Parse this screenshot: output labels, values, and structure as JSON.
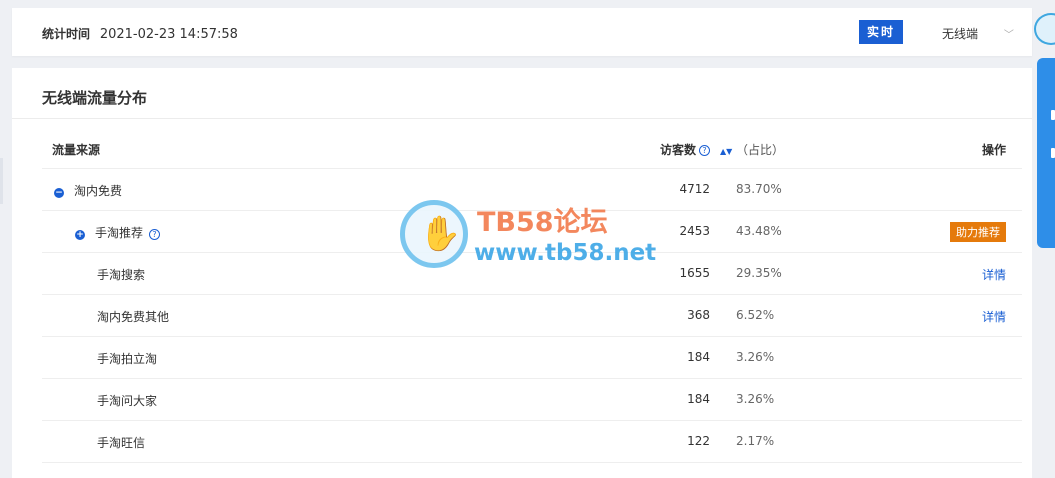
{
  "topbar": {
    "stat_label": "统计时间",
    "stat_time": "2021-02-23 14:57:58",
    "realtime_btn": "实时",
    "device": "无线端",
    "device_chevron": "﹀"
  },
  "card": {
    "title": "无线端流量分布",
    "headers": {
      "source": "流量来源",
      "visitors": "访客数",
      "ratio": "（占比）",
      "op": "操作"
    }
  },
  "rows": [
    {
      "source": "淘内免费",
      "visitors": "4712",
      "ratio": "83.70%",
      "op": ""
    },
    {
      "source": "手淘推荐",
      "visitors": "2453",
      "ratio": "43.48%",
      "op": "助力推荐"
    },
    {
      "source": "手淘搜索",
      "visitors": "1655",
      "ratio": "29.35%",
      "op": "详情"
    },
    {
      "source": "淘内免费其他",
      "visitors": "368",
      "ratio": "6.52%",
      "op": "详情"
    },
    {
      "source": "手淘拍立淘",
      "visitors": "184",
      "ratio": "3.26%",
      "op": ""
    },
    {
      "source": "手淘问大家",
      "visitors": "184",
      "ratio": "3.26%",
      "op": ""
    },
    {
      "source": "手淘旺信",
      "visitors": "122",
      "ratio": "2.17%",
      "op": ""
    }
  ],
  "watermark": {
    "title": "TB58论坛",
    "url": "www.tb58.net"
  },
  "colors": {
    "accent": "#1a5fd3",
    "boost": "#e57a0b",
    "side_panel": "#2e8ee8"
  },
  "icons": {
    "collapse": "minus-circle-icon",
    "expand": "plus-circle-icon",
    "help": "question-circle-icon",
    "sort": "sort-icon"
  }
}
